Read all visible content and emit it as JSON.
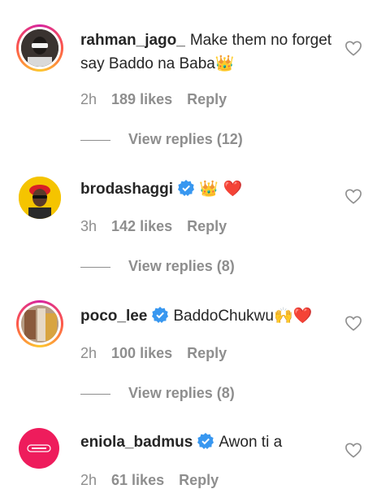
{
  "comments": [
    {
      "username": "rahman_jago_",
      "verified": false,
      "text": "Make them no forget say Baddo na Baba",
      "emoji": "👑",
      "time": "2h",
      "likes": "189 likes",
      "reply_label": "Reply",
      "view_replies": "View replies (12)"
    },
    {
      "username": "brodashaggi",
      "verified": true,
      "text": "",
      "emoji": "👑 ❤️",
      "time": "3h",
      "likes": "142 likes",
      "reply_label": "Reply",
      "view_replies": "View replies (8)"
    },
    {
      "username": "poco_lee",
      "verified": true,
      "text": "BaddoChukwu",
      "emoji": "🙌❤️",
      "time": "2h",
      "likes": "100 likes",
      "reply_label": "Reply",
      "view_replies": "View replies (8)"
    },
    {
      "username": "eniola_badmus",
      "verified": true,
      "text": "Awon ti a",
      "emoji": "",
      "time": "2h",
      "likes": "61 likes",
      "reply_label": "Reply"
    }
  ],
  "colors": {
    "verified": "#3897f0",
    "muted": "#8e8e8e",
    "text": "#262626"
  }
}
